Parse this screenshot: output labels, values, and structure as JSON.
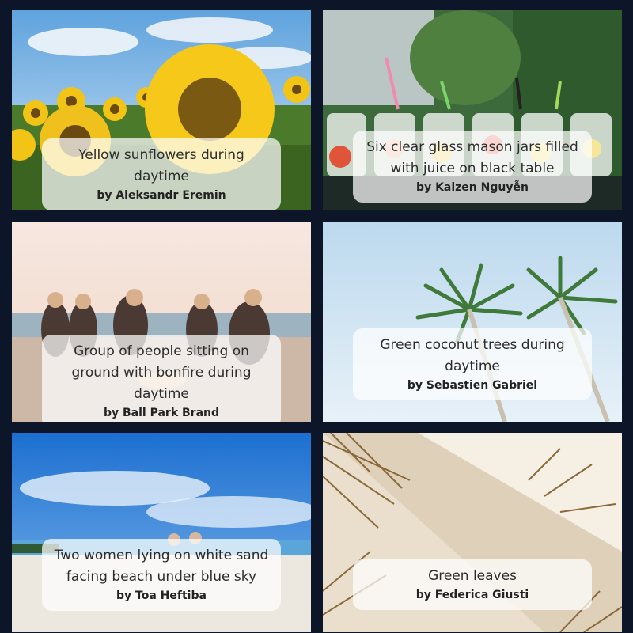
{
  "gallery": {
    "photos": [
      {
        "title": "Yellow sunflowers during daytime",
        "author": "by Aleksandr Eremin"
      },
      {
        "title": "Six clear glass mason jars filled with juice on black table",
        "author": "by Kaizen Nguyễn"
      },
      {
        "title": "Group of people sitting on ground with bonfire during daytime",
        "author": "by Ball Park Brand"
      },
      {
        "title": "Green coconut trees during daytime",
        "author": "by Sebastien Gabriel"
      },
      {
        "title": "Two women lying on white sand facing beach under blue sky",
        "author": "by Toa Heftiba"
      },
      {
        "title": "Green leaves",
        "author": "by Federica Giusti"
      }
    ]
  },
  "colors": {
    "background": "#0d1628",
    "caption_bg": "#ffffffb8",
    "text": "#2c2c2c"
  }
}
